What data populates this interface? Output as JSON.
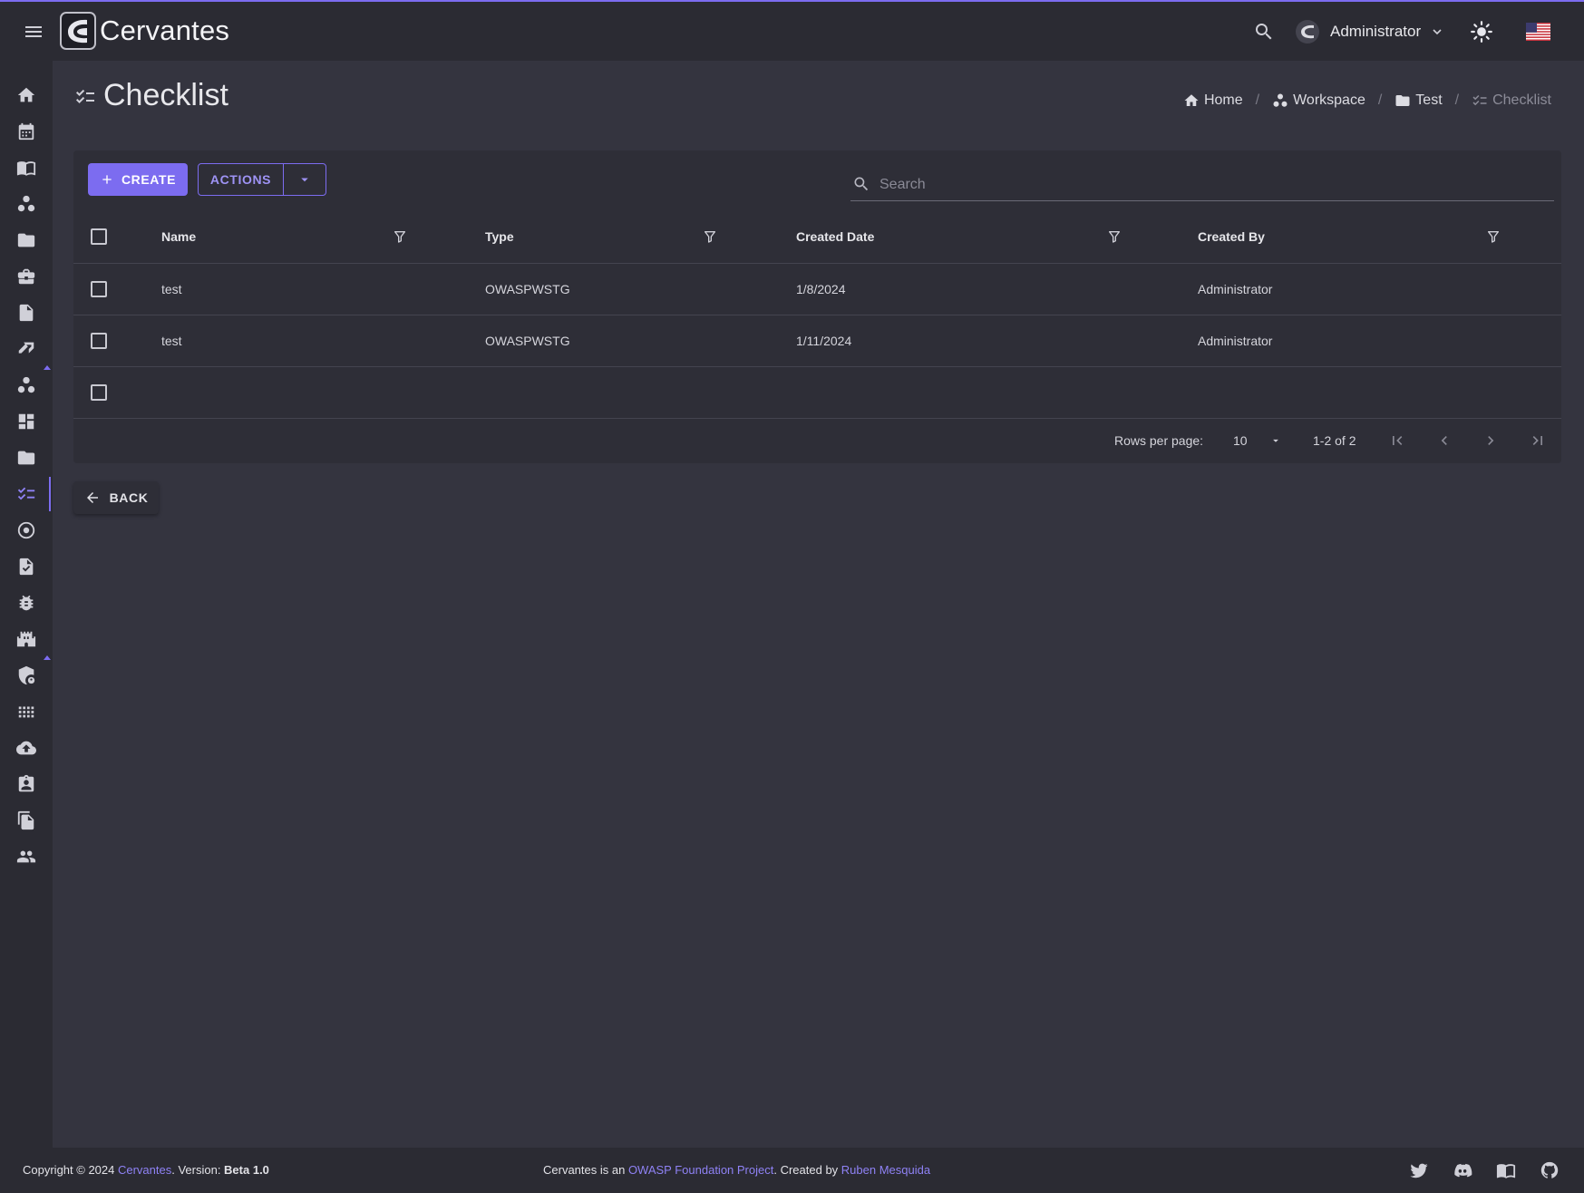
{
  "app": {
    "brand": "Cervantes",
    "accent_color": "#7c6cf0"
  },
  "header": {
    "menu_icon": "menu-icon",
    "search_icon": "search-icon",
    "user": {
      "name": "Administrator",
      "icon": "user-avatar"
    },
    "theme_icon": "sun-icon",
    "language_icon": "us-flag-icon"
  },
  "sidebar": {
    "items": [
      {
        "icon": "home-icon"
      },
      {
        "icon": "calendar-icon"
      },
      {
        "icon": "book-icon"
      },
      {
        "icon": "workspace-icon"
      },
      {
        "icon": "folder-icon"
      },
      {
        "icon": "briefcase-icon"
      },
      {
        "icon": "document-icon"
      },
      {
        "icon": "stack-icon"
      },
      {
        "icon": "workspace-icon",
        "expanded": true
      },
      {
        "icon": "dashboard-icon"
      },
      {
        "icon": "folder-icon"
      },
      {
        "icon": "checklist-icon",
        "active": true
      },
      {
        "icon": "target-icon"
      },
      {
        "icon": "task-icon"
      },
      {
        "icon": "bug-icon"
      },
      {
        "icon": "castle-icon"
      },
      {
        "icon": "shield-icon",
        "expanded": true
      },
      {
        "icon": "apps-icon"
      },
      {
        "icon": "cloud-upload-icon"
      },
      {
        "icon": "badge-icon"
      },
      {
        "icon": "copy-icon"
      },
      {
        "icon": "people-icon"
      }
    ]
  },
  "page": {
    "title": "Checklist",
    "breadcrumb": [
      {
        "label": "Home",
        "icon": "home-icon"
      },
      {
        "label": "Workspace",
        "icon": "workspace-icon"
      },
      {
        "label": "Test",
        "icon": "folder-icon"
      },
      {
        "label": "Checklist",
        "icon": "checklist-icon",
        "current": true
      }
    ]
  },
  "toolbar": {
    "create_label": "CREATE",
    "actions_label": "ACTIONS",
    "search_placeholder": "Search"
  },
  "table": {
    "columns": [
      "Name",
      "Type",
      "Created Date",
      "Created By"
    ],
    "rows": [
      {
        "name": "test",
        "type": "OWASPWSTG",
        "created_date": "1/8/2024",
        "created_by": "Administrator"
      },
      {
        "name": "test",
        "type": "OWASPWSTG",
        "created_date": "1/11/2024",
        "created_by": "Administrator"
      }
    ]
  },
  "pagination": {
    "rows_per_page_label": "Rows per page:",
    "rows_per_page": "10",
    "range": "1-2 of 2"
  },
  "back_label": "BACK",
  "footer": {
    "copyright_prefix": "Copyright © 2024 ",
    "brand_link": "Cervantes",
    "version_prefix": ". Version: ",
    "version": "Beta 1.0",
    "project_prefix": "Cervantes is an ",
    "project_link": "OWASP Foundation Project",
    "created_prefix": ". Created by ",
    "author_link": "Ruben Mesquida",
    "social": [
      "twitter-icon",
      "discord-icon",
      "docs-icon",
      "github-icon"
    ]
  }
}
